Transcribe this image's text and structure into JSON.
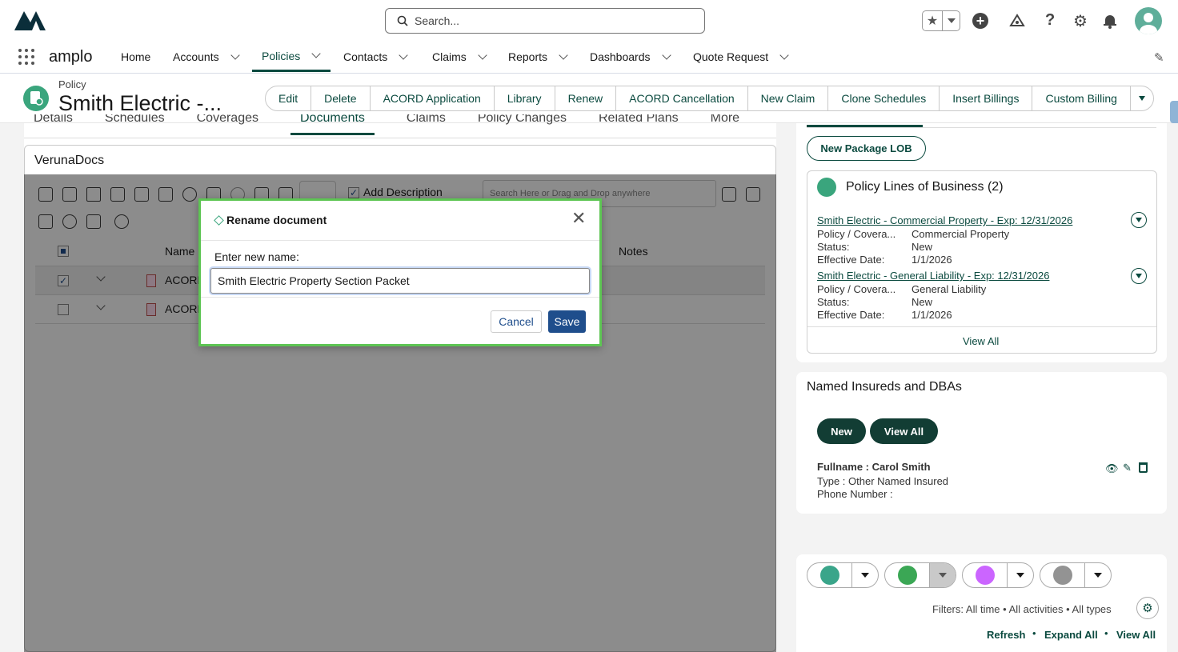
{
  "app": {
    "name": "amplo",
    "search_placeholder": "Search..."
  },
  "nav": {
    "items": [
      {
        "label": "Home"
      },
      {
        "label": "Accounts"
      },
      {
        "label": "Policies"
      },
      {
        "label": "Contacts"
      },
      {
        "label": "Claims"
      },
      {
        "label": "Reports"
      },
      {
        "label": "Dashboards"
      },
      {
        "label": "Quote Request"
      }
    ]
  },
  "record": {
    "type": "Policy",
    "title": "Smith Electric -..."
  },
  "actions": [
    "Edit",
    "Delete",
    "ACORD Application",
    "Library",
    "Renew",
    "ACORD Cancellation",
    "New Claim",
    "Clone Schedules",
    "Insert Billings",
    "Custom Billing"
  ],
  "tabs": [
    "Details",
    "Schedules",
    "Coverages",
    "Documents",
    "Claims",
    "Policy Changes",
    "Related Plans",
    "More"
  ],
  "docs": {
    "title": "VerunaDocs",
    "add_description": "Add Description",
    "search_placeholder": "Search Here or Drag and Drop anywhere",
    "col_name": "Name",
    "col_notes": "Notes",
    "rows": [
      {
        "name": "ACORD"
      },
      {
        "name": "ACORD"
      }
    ]
  },
  "modal": {
    "title": "Rename document",
    "label": "Enter new name:",
    "value": "Smith Electric Property Section Packet",
    "cancel": "Cancel",
    "save": "Save"
  },
  "right": {
    "new_package_lob": "New Package LOB",
    "plob_title": "Policy Lines of Business (2)",
    "lobs": [
      {
        "link": "Smith Electric - Commercial Property - Exp: 12/31/2026",
        "k1": "Policy / Covera...",
        "v1": "Commercial Property",
        "k2": "Status:",
        "v2": "New",
        "k3": "Effective Date:",
        "v3": "1/1/2026"
      },
      {
        "link": "Smith Electric - General Liability - Exp: 12/31/2026",
        "k1": "Policy / Covera...",
        "v1": "General Liability",
        "k2": "Status:",
        "v2": "New",
        "k3": "Effective Date:",
        "v3": "1/1/2026"
      }
    ],
    "view_all": "View All",
    "named_title": "Named Insureds and DBAs",
    "named_new": "New",
    "named_view_all": "View All",
    "insured_fullname": "Fullname : Carol Smith",
    "insured_type": "Type : Other Named Insured",
    "insured_phone": "Phone Number :",
    "filters": "Filters: All time • All activities • All types",
    "refresh": "Refresh",
    "expand_all": "Expand All",
    "activity_view_all": "View All"
  },
  "colors": {
    "brand": "#0b4a3f",
    "modal_border": "#5dc553",
    "save_btn": "#1f4e8c"
  }
}
